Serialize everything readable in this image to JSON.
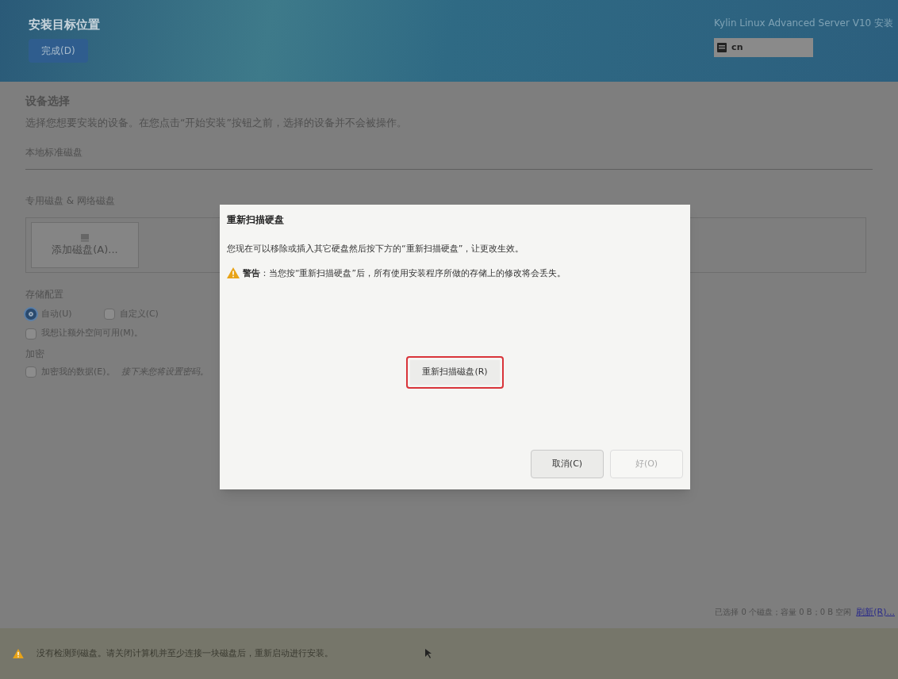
{
  "header": {
    "title": "安装目标位置",
    "done_button": "完成(D)",
    "product": "Kylin Linux Advanced Server V10 安装",
    "keyboard": "cn"
  },
  "device_selection": {
    "heading": "设备选择",
    "description": "选择您想要安装的设备。在您点击“开始安装”按钮之前，选择的设备并不会被操作。",
    "local_disks": "本地标准磁盘",
    "special_disks": "专用磁盘 & 网络磁盘",
    "add_disk_button": "添加磁盘(A)..."
  },
  "storage_config": {
    "heading": "存储配置",
    "options": [
      {
        "kind": "radio",
        "label": "自动(U)",
        "selected": true
      },
      {
        "kind": "checkbox",
        "label": "自定义(C)",
        "checked": false
      }
    ],
    "extra_space": {
      "label": "我想让额外空间可用(M)。",
      "checked": false
    }
  },
  "encryption": {
    "heading": "加密",
    "option": {
      "label": "加密我的数据(E)。",
      "checked": false
    },
    "hint": "接下来您将设置密码。"
  },
  "summary": {
    "text": "已选择 0 个磁盘；容量 0 B；0 B 空闲",
    "refresh_link": "刷新(R)..."
  },
  "status_bar": {
    "message": "没有检测到磁盘。请关闭计算机并至少连接一块磁盘后，重新启动进行安装。"
  },
  "dialog": {
    "title": "重新扫描硬盘",
    "message": "您现在可以移除或插入其它硬盘然后按下方的“重新扫描硬盘”，让更改生效。",
    "warning": "**警告**：当您按“重新扫描硬盘”后，所有使用安装程序所做的存储上的修改将会丢失。",
    "rescan_button": {
      "label": "重新扫描磁盘(R)",
      "highlighted": true
    },
    "buttons": [
      {
        "label": "取消(C)",
        "disabled": false
      },
      {
        "label": "好(O)",
        "disabled": true
      }
    ]
  }
}
